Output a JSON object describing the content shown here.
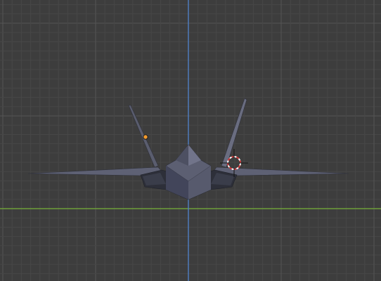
{
  "app": "3D Viewport",
  "viewport": {
    "view": "front-orthographic",
    "background": "#3d3d3d",
    "grid_minor_color": "#474747",
    "grid_major_color": "#555555",
    "axis_colors": {
      "vertical_z": "#4f7fc4",
      "horizontal_y": "#6f9f3a"
    }
  },
  "scene_objects": [
    {
      "name": "jet-aircraft-mesh",
      "type": "mesh",
      "color": "#4a4d5e",
      "selected": false
    },
    {
      "name": "light-object",
      "type": "light",
      "color": "#f29a2e"
    },
    {
      "name": "3d-cursor",
      "type": "cursor",
      "color_a": "#ffffff",
      "color_b": "#d13a3a"
    }
  ]
}
